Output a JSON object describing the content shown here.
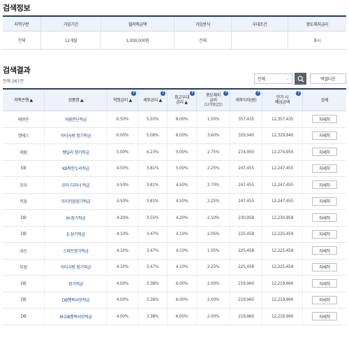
{
  "info_section": {
    "title": "검색정보",
    "headers": [
      "지역구분",
      "가입기간",
      "월저축금액",
      "가입방식",
      "우대조건",
      "중도해지금리"
    ],
    "values": [
      "전체",
      "12개월",
      "1,000,000원",
      "전체",
      "",
      "표시"
    ]
  },
  "results_section": {
    "title": "검색결과",
    "count_prefix": "전체 ",
    "count_num": "267",
    "count_suffix": "건",
    "filter_value": "전체",
    "excel_label": "엑셀다운",
    "headers": {
      "bank": "저축은행",
      "product": "상품명",
      "base_rate": "약정금리",
      "after_tax_rate": "세후금리",
      "max_rate_1": "최고우대",
      "max_rate_2": "금리",
      "early_1": "중도해지",
      "early_2": "금리",
      "early_3": "(12개월납입)",
      "interest": "세후이자(원)",
      "maturity_1": "만기 시",
      "maturity_2": "예상금액",
      "detail": "상세"
    },
    "detail_label": "자세히",
    "rows": [
      {
        "bank": "애큐온",
        "product": "처음만난적금",
        "rate": "6.50%",
        "after_tax": "5.50%",
        "max": "8.00%",
        "early": "1.50%",
        "interest": "357,435",
        "maturity": "12,357,435"
      },
      {
        "bank": "엠에스",
        "product": "아이사랑 정기적금",
        "rate": "6.00%",
        "after_tax": "5.08%",
        "max": "6.00%",
        "early": "3.60%",
        "interest": "329,940",
        "maturity": "12,329,940"
      },
      {
        "bank": "세람",
        "product": "쨍일리 정기적금",
        "rate": "5.00%",
        "after_tax": "4.23%",
        "max": "5.00%",
        "early": "2.75%",
        "interest": "274,950",
        "maturity": "12,274,950"
      },
      {
        "bank": "KB",
        "product": "KB착한누리적금",
        "rate": "4.50%",
        "after_tax": "3.81%",
        "max": "5.00%",
        "early": "2.25%",
        "interest": "247,455",
        "maturity": "12,247,455"
      },
      {
        "bank": "모아",
        "product": "모아 디자너 적금",
        "rate": "4.50%",
        "after_tax": "3.81%",
        "max": "4.50%",
        "early": "2.70%",
        "interest": "247,455",
        "maturity": "12,247,455"
      },
      {
        "bank": "키움",
        "product": "아이키움정기적금",
        "rate": "4.50%",
        "after_tax": "3.81%",
        "max": "4.50%",
        "early": "2.25%",
        "interest": "247,455",
        "maturity": "12,247,455"
      },
      {
        "bank": "DB",
        "product": "M-정기적금",
        "rate": "4.20%",
        "after_tax": "3.55%",
        "max": "4.20%",
        "early": "2.10%",
        "interest": "230,958",
        "maturity": "12,230,958"
      },
      {
        "bank": "DB",
        "product": "E-정기적금",
        "rate": "4.10%",
        "after_tax": "3.47%",
        "max": "4.10%",
        "early": "2.05%",
        "interest": "225,458",
        "maturity": "12,225,459"
      },
      {
        "bank": "대신",
        "product": "스마트정기적금",
        "rate": "4.10%",
        "after_tax": "3.47%",
        "max": "4.10%",
        "early": "1.05%",
        "interest": "225,458",
        "maturity": "12,225,459"
      },
      {
        "bank": "부림",
        "product": "아이사랑 정기적금",
        "rate": "4.10%",
        "after_tax": "3.47%",
        "max": "4.10%",
        "early": "2.25%",
        "interest": "225,458",
        "maturity": "12,225,459"
      },
      {
        "bank": "DB",
        "product": "정기적금",
        "rate": "4.00%",
        "after_tax": "3.38%",
        "max": "6.00%",
        "early": "2.00%",
        "interest": "219,960",
        "maturity": "12,219,960"
      },
      {
        "bank": "DB",
        "product": "DB행복씨앗적금",
        "rate": "4.00%",
        "after_tax": "3.38%",
        "max": "6.00%",
        "early": "2.00%",
        "interest": "219,960",
        "maturity": "12,219,960"
      },
      {
        "bank": "DB",
        "product": "M-DB행복씨앗적금",
        "rate": "4.00%",
        "after_tax": "3.38%",
        "max": "6.00%",
        "early": "2.00%",
        "interest": "219,960",
        "maturity": "12,219,960"
      }
    ]
  }
}
